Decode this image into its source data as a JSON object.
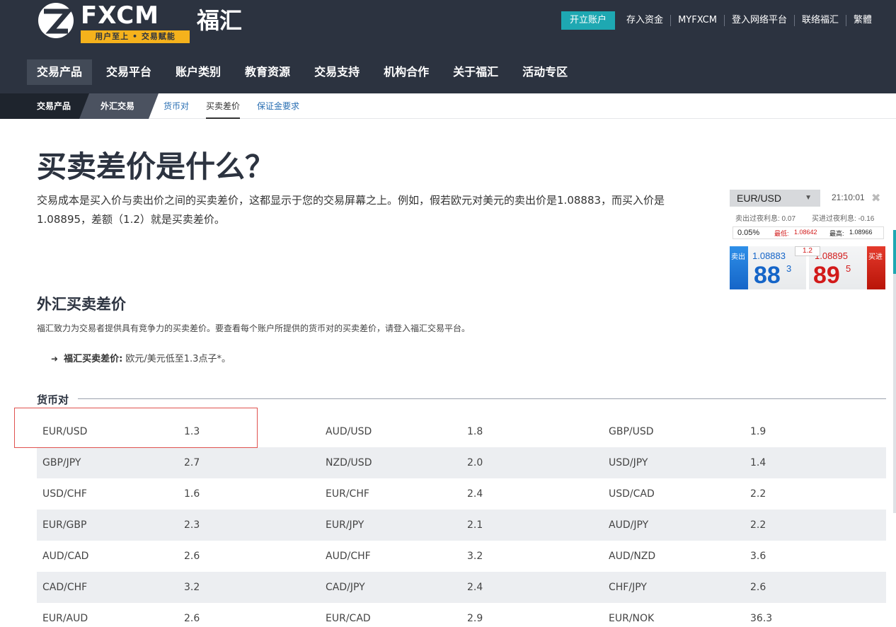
{
  "brand": {
    "name": "FXCM",
    "cn_name": "福汇",
    "slogan": "用户至上 • 交易赋能",
    "accent_color": "#1ea8b2",
    "slogan_color": "#f5b21c",
    "header_color": "#2c3340"
  },
  "top_links": {
    "open_account": "开立账户",
    "items": [
      "存入资金",
      "MYFXCM",
      "登入网络平台",
      "联络福汇",
      "繁體"
    ]
  },
  "main_nav": [
    "交易产品",
    "交易平台",
    "账户类别",
    "教育资源",
    "交易支持",
    "机构合作",
    "关于福汇",
    "活动专区"
  ],
  "breadcrumb": [
    "交易产品",
    "外汇交易"
  ],
  "sub_nav": [
    "货币对",
    "买卖差价",
    "保证金要求"
  ],
  "page": {
    "title": "买卖差价是什么？",
    "intro": "交易成本是买入价与卖出价之间的买卖差价，这都显示于您的交易屏幕之上。例如，假若欧元对美元的卖出价是1.08883，而买入价是1.08895，差额（1.2）就是买卖差价。",
    "section_title": "外汇买卖差价",
    "section_desc": "福汇致力为交易者提供具有竞争力的买卖差价。要查看每个账户所提供的货币对的买卖差价，请登入福汇交易平台。",
    "bullet_label": "福汇买卖差价:",
    "bullet_text": " 欧元/美元低至1.3点子*。"
  },
  "table": {
    "header": "货币对",
    "rows": [
      [
        "EUR/USD",
        "1.3",
        "AUD/USD",
        "1.8",
        "GBP/USD",
        "1.9"
      ],
      [
        "GBP/JPY",
        "2.7",
        "NZD/USD",
        "2.0",
        "USD/JPY",
        "1.4"
      ],
      [
        "USD/CHF",
        "1.6",
        "EUR/CHF",
        "2.4",
        "USD/CAD",
        "2.2"
      ],
      [
        "EUR/GBP",
        "2.3",
        "EUR/JPY",
        "2.1",
        "AUD/JPY",
        "2.2"
      ],
      [
        "AUD/CAD",
        "2.6",
        "AUD/CHF",
        "3.2",
        "AUD/NZD",
        "3.6"
      ],
      [
        "CAD/CHF",
        "3.2",
        "CAD/JPY",
        "2.4",
        "CHF/JPY",
        "2.6"
      ],
      [
        "EUR/AUD",
        "2.6",
        "EUR/CAD",
        "2.9",
        "EUR/NOK",
        "36.3"
      ]
    ]
  },
  "widget": {
    "pair": "EUR/USD",
    "time": "21:10:01",
    "close_icon": "close-icon",
    "sell_rollover": "卖出过夜利息: 0.07",
    "buy_rollover": "买进过夜利息: -0.16",
    "change": "0.05%",
    "low_label": "最低:",
    "low_value": "1.08642",
    "high_label": "最高:",
    "high_value": "1.08966",
    "sell_label": "卖出",
    "sell_price": "1.08883",
    "sell_big": "88",
    "sell_sup": "3",
    "buy_label": "买进",
    "buy_price": "1.08895",
    "buy_big": "89",
    "buy_sup": "5",
    "spread": "1.2",
    "sell_color": "#1565c8",
    "buy_color": "#d21a1a"
  }
}
